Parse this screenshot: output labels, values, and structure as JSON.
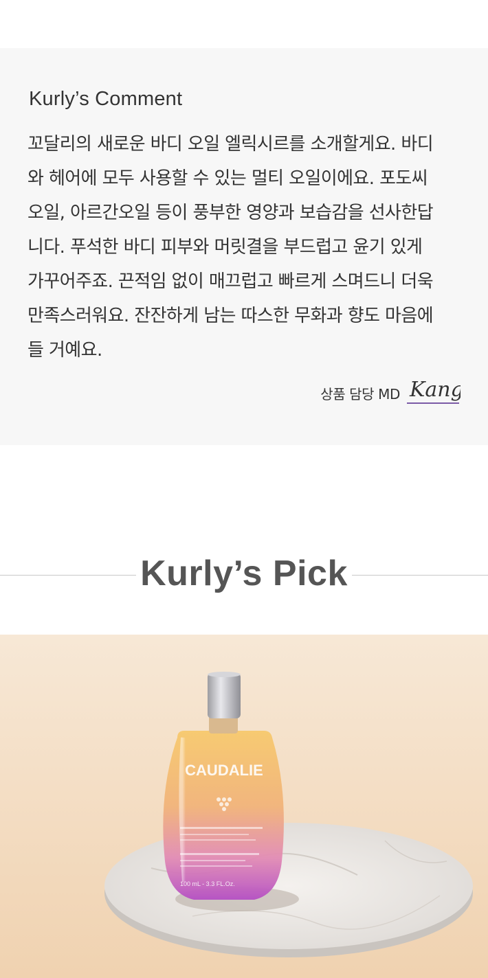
{
  "comment": {
    "title": "Kurly’s Comment",
    "lines": [
      "꼬달리의 새로운 바디 오일 엘릭시르를 소개할게요. 바디",
      "와 헤어에 모두 사용할 수 있는 멀티 오일이에요. 포도씨",
      "오일, 아르간오일 등이 풍부한 영양과 보습감을 선사한답",
      "니다. 푸석한 바디 피부와 머릿결을 부드럽고 윤기 있게",
      "가꾸어주죠. 끈적임 없이 매끄럽고 빠르게 스며드니 더욱",
      "만족스러워요. 잔잔하게 남는 따스한 무화과 향도 마음에",
      "들 거예요."
    ],
    "md_label": "상품 담당 MD",
    "signature": "Kang",
    "signature_color": "#7b5aa6"
  },
  "pick": {
    "title": "Kurly’s Pick"
  },
  "product_image": {
    "brand": "CAUDALIE",
    "volume": "100 mL - 3.3 FL.Oz.",
    "colors": {
      "background_top": "#f6e5d2",
      "background_bottom": "#f1d4b4",
      "bottle_top": "#f6c86e",
      "bottle_bottom": "#c45ac9",
      "cap": "#bfbfc3"
    }
  }
}
